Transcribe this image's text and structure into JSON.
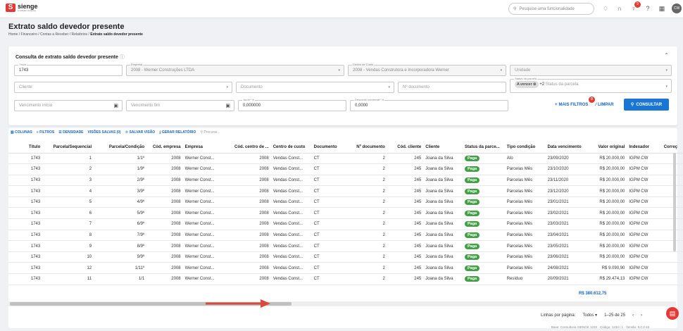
{
  "brand": {
    "name": "sienge",
    "sub": "a softplan company"
  },
  "search": {
    "placeholder": "Pesquise uma funcionalidade"
  },
  "notif_badge": "9",
  "avatar": "CW",
  "page": {
    "title": "Extrato saldo devedor presente",
    "breadcrumb": [
      "Home",
      "Financeiro",
      "Contas a Receber",
      "Relatórios"
    ],
    "breadcrumb_current": "Extrato saldo devedor presente"
  },
  "form": {
    "title": "Consulta de extrato saldo devedor presente",
    "titulo": {
      "label": "Título",
      "value": "1743"
    },
    "empresa": {
      "label": "Empresa",
      "value": "2008 - Werner Construções LTDA"
    },
    "centro": {
      "label": "Centro de Custo",
      "value": "2008 - Vendas Construtora e Incorporadora Werner"
    },
    "unidade": {
      "placeholder": "Unidade"
    },
    "cliente": {
      "placeholder": "Cliente"
    },
    "documento": {
      "placeholder": "Documento"
    },
    "numdoc": {
      "placeholder": "Nº documento"
    },
    "status": {
      "label": "Status da parcela",
      "chip": "A vencer",
      "more": "+2",
      "placeholder": "Status da parcela"
    },
    "venc_inicio": {
      "placeholder": "Vencimento início"
    },
    "venc_fim": {
      "placeholder": "Vencimento fim"
    },
    "juros": {
      "label": "Juros* %",
      "value": "0,000000"
    },
    "desconto": {
      "label": "Desconto comercial* %",
      "value": "0,0000"
    },
    "mais_filtros": "MAIS FILTROS",
    "mais_badge": "0",
    "limpar": "LIMPAR",
    "consultar": "CONSULTAR"
  },
  "toolbar": {
    "colunas": "COLUNAS",
    "filtros": "FILTROS",
    "densidade": "DENSIDADE",
    "visoes": "VISÕES SALVAS (0)",
    "salvar": "SALVAR VISÃO",
    "gerar": "GERAR RELATÓRIO",
    "procurar": "Procurar..."
  },
  "table": {
    "headers": [
      "Título",
      "Parcela/Sequencial",
      "Parcela/Condição",
      "Cód. empresa",
      "Empresa",
      "Cód. centro de ...",
      "Centro de custo",
      "Documento",
      "Nº documento",
      "Cód. cliente",
      "Cliente",
      "Status da parce...",
      "Tipo condição",
      "Data vencimento",
      "Valor original",
      "Indexador",
      "Correç"
    ],
    "rows": [
      [
        "1743",
        "1",
        "1/1º",
        "2008",
        "Werner Const...",
        "2008",
        "Vendas Const...",
        "CT",
        "2",
        "245",
        "Joana da Silva",
        "Paga",
        "Ato",
        "23/09/2020",
        "R$ 20.000,00",
        "IGPM CW"
      ],
      [
        "1743",
        "2",
        "1/9º",
        "2008",
        "Werner Const...",
        "2008",
        "Vendas Const...",
        "CT",
        "2",
        "245",
        "Joana da Silva",
        "Paga",
        "Parcelas Mês",
        "23/10/2020",
        "R$ 20.000,00",
        "IGPM CW"
      ],
      [
        "1743",
        "3",
        "2/9º",
        "2008",
        "Werner Const...",
        "2008",
        "Vendas Const...",
        "CT",
        "2",
        "245",
        "Joana da Silva",
        "Paga",
        "Parcelas Mês",
        "23/11/2020",
        "R$ 20.000,00",
        "IGPM CW"
      ],
      [
        "1743",
        "4",
        "3/9º",
        "2008",
        "Werner Const...",
        "2008",
        "Vendas Const...",
        "CT",
        "2",
        "245",
        "Joana da Silva",
        "Paga",
        "Parcelas Mês",
        "23/12/2020",
        "R$ 20.000,00",
        "IGPM CW"
      ],
      [
        "1743",
        "5",
        "4/9º",
        "2008",
        "Werner Const...",
        "2008",
        "Vendas Const...",
        "CT",
        "2",
        "245",
        "Joana da Silva",
        "Paga",
        "Parcelas Mês",
        "23/01/2021",
        "R$ 20.000,00",
        "IGPM CW"
      ],
      [
        "1743",
        "6",
        "5/9º",
        "2008",
        "Werner Const...",
        "2008",
        "Vendas Const...",
        "CT",
        "2",
        "245",
        "Joana da Silva",
        "Paga",
        "Parcelas Mês",
        "23/02/2021",
        "R$ 20.000,00",
        "IGPM CW"
      ],
      [
        "1743",
        "7",
        "6/9º",
        "2008",
        "Werner Const...",
        "2008",
        "Vendas Const...",
        "CT",
        "2",
        "245",
        "Joana da Silva",
        "Paga",
        "Parcelas Mês",
        "23/03/2021",
        "R$ 20.000,00",
        "IGPM CW"
      ],
      [
        "1743",
        "8",
        "7/9º",
        "2008",
        "Werner Const...",
        "2008",
        "Vendas Const...",
        "CT",
        "2",
        "245",
        "Joana da Silva",
        "Paga",
        "Parcelas Mês",
        "23/04/2021",
        "R$ 20.000,00",
        "IGPM CW"
      ],
      [
        "1743",
        "9",
        "8/9º",
        "2008",
        "Werner Const...",
        "2008",
        "Vendas Const...",
        "CT",
        "2",
        "245",
        "Joana da Silva",
        "Paga",
        "Parcelas Mês",
        "23/05/2021",
        "R$ 20.000,00",
        "IGPM CW"
      ],
      [
        "1743",
        "10",
        "9/9º",
        "2008",
        "Werner Const...",
        "2008",
        "Vendas Const...",
        "CT",
        "2",
        "245",
        "Joana da Silva",
        "Paga",
        "Parcelas Mês",
        "23/06/2021",
        "R$ 20.000,00",
        "IGPM CW"
      ],
      [
        "1743",
        "12",
        "1/11º",
        "2008",
        "Werner Const...",
        "2008",
        "Vendas Const...",
        "CT",
        "2",
        "245",
        "Joana da Silva",
        "Paga",
        "Parcelas Mês",
        "24/08/2021",
        "R$ 9.090,90",
        "IGPM CW"
      ],
      [
        "1743",
        "11",
        "1/1",
        "2008",
        "Werner Const...",
        "2008",
        "Vendas Const...",
        "CT",
        "2",
        "245",
        "Joana da Silva",
        "Paga",
        "Resíduo",
        "20/09/2021",
        "R$ 29.474,13",
        "IGPM CW"
      ]
    ],
    "total": "R$ 380.612,75"
  },
  "pagination": {
    "label": "Linhas por página:",
    "value": "Todos",
    "range": "1–25 de 25"
  },
  "footer": "Base: Consultoria SIENGE 1233 · Código: 1233 / 1 · Versão: 9.0.3-19"
}
